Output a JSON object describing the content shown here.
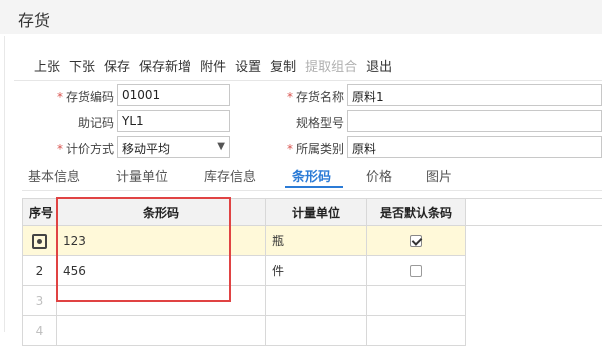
{
  "window": {
    "title": "存货"
  },
  "toolbar": {
    "buttons": [
      {
        "label": "上张",
        "disabled": false
      },
      {
        "label": "下张",
        "disabled": false
      },
      {
        "label": "保存",
        "disabled": false
      },
      {
        "label": "保存新增",
        "disabled": false
      },
      {
        "label": "附件",
        "disabled": false
      },
      {
        "label": "设置",
        "disabled": false
      },
      {
        "label": "复制",
        "disabled": false
      },
      {
        "label": "提取组合",
        "disabled": true
      },
      {
        "label": "退出",
        "disabled": false
      }
    ]
  },
  "form": {
    "code_label": "存货编码",
    "code_value": "01001",
    "mnemonic_label": "助记码",
    "mnemonic_value": "YL1",
    "valuation_label": "计价方式",
    "valuation_value": "移动平均",
    "name_label": "存货名称",
    "name_value": "原料1",
    "spec_label": "规格型号",
    "spec_value": "",
    "category_label": "所属类别",
    "category_value": "原料",
    "required_mark": "*"
  },
  "tabs": [
    {
      "label": "基本信息",
      "active": false
    },
    {
      "label": "计量单位",
      "active": false
    },
    {
      "label": "库存信息",
      "active": false
    },
    {
      "label": "条形码",
      "active": true
    },
    {
      "label": "价格",
      "active": false
    },
    {
      "label": "图片",
      "active": false
    }
  ],
  "grid": {
    "columns": [
      "序号",
      "条形码",
      "计量单位",
      "是否默认条码"
    ],
    "rows": [
      {
        "index": "",
        "barcode": "123",
        "unit": "瓶",
        "is_default": true,
        "selected": true
      },
      {
        "index": "2",
        "barcode": "456",
        "unit": "件",
        "is_default": false,
        "selected": false
      },
      {
        "index": "3",
        "barcode": "",
        "unit": "",
        "is_default": null,
        "selected": false
      },
      {
        "index": "4",
        "barcode": "",
        "unit": "",
        "is_default": null,
        "selected": false
      }
    ]
  },
  "colors": {
    "accent": "#2b7bd6",
    "required": "#d9534f",
    "highlight": "#e04343",
    "selected_row": "#fff9d9"
  }
}
